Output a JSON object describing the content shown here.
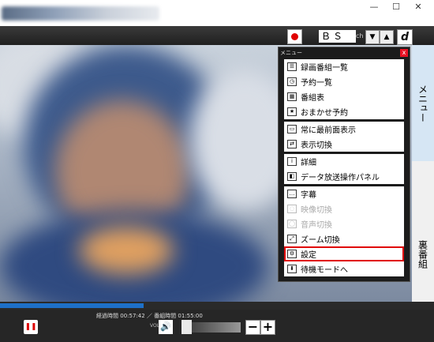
{
  "window": {
    "minimize": "—",
    "maximize": "☐",
    "close": "✕"
  },
  "toolbar": {
    "channel": "ＢＳ",
    "ch_label": "ch",
    "up": "▲",
    "down": "▼",
    "d_button": "d"
  },
  "menu": {
    "title": "メニュー",
    "close": "x",
    "groups": [
      [
        {
          "label": "録画番組一覧",
          "icon": "list-icon",
          "glyph": "☰"
        },
        {
          "label": "予約一覧",
          "icon": "reservation-list-icon",
          "glyph": "◷"
        },
        {
          "label": "番組表",
          "icon": "program-guide-icon",
          "glyph": "▦"
        },
        {
          "label": "おまかせ予約",
          "icon": "auto-reserve-icon",
          "glyph": "★"
        }
      ],
      [
        {
          "label": "常に最前面表示",
          "icon": "always-on-top-icon",
          "glyph": "▭"
        },
        {
          "label": "表示切換",
          "icon": "display-switch-icon",
          "glyph": "⇄"
        }
      ],
      [
        {
          "label": "詳細",
          "icon": "info-icon",
          "glyph": "i"
        },
        {
          "label": "データ放送操作パネル",
          "icon": "data-broadcast-icon",
          "glyph": "◧"
        }
      ],
      [
        {
          "label": "字幕",
          "icon": "subtitle-icon",
          "glyph": "…"
        },
        {
          "label": "映像切換",
          "icon": "video-switch-icon",
          "glyph": "◌",
          "disabled": true
        },
        {
          "label": "音声切換",
          "icon": "audio-switch-icon",
          "glyph": "◯",
          "disabled": true
        },
        {
          "label": "ズーム切換",
          "icon": "zoom-switch-icon",
          "glyph": "⤢"
        },
        {
          "label": "設定",
          "icon": "settings-icon",
          "glyph": "⚙",
          "highlight": true
        },
        {
          "label": "待機モードへ",
          "icon": "standby-icon",
          "glyph": "⬇"
        }
      ]
    ]
  },
  "side_tabs": {
    "menu": "メニュー",
    "reverse_program": "裏番組"
  },
  "playback": {
    "elapsed_label": "経過時間",
    "elapsed": "00:57:42",
    "sep": "／",
    "duration_label": "番組時間",
    "duration": "01:55:00",
    "vol_label": "VOL",
    "progress": 0.33
  },
  "colors": {
    "accent": "#1e70c8",
    "highlight": "#e00000",
    "record": "#e00000"
  }
}
